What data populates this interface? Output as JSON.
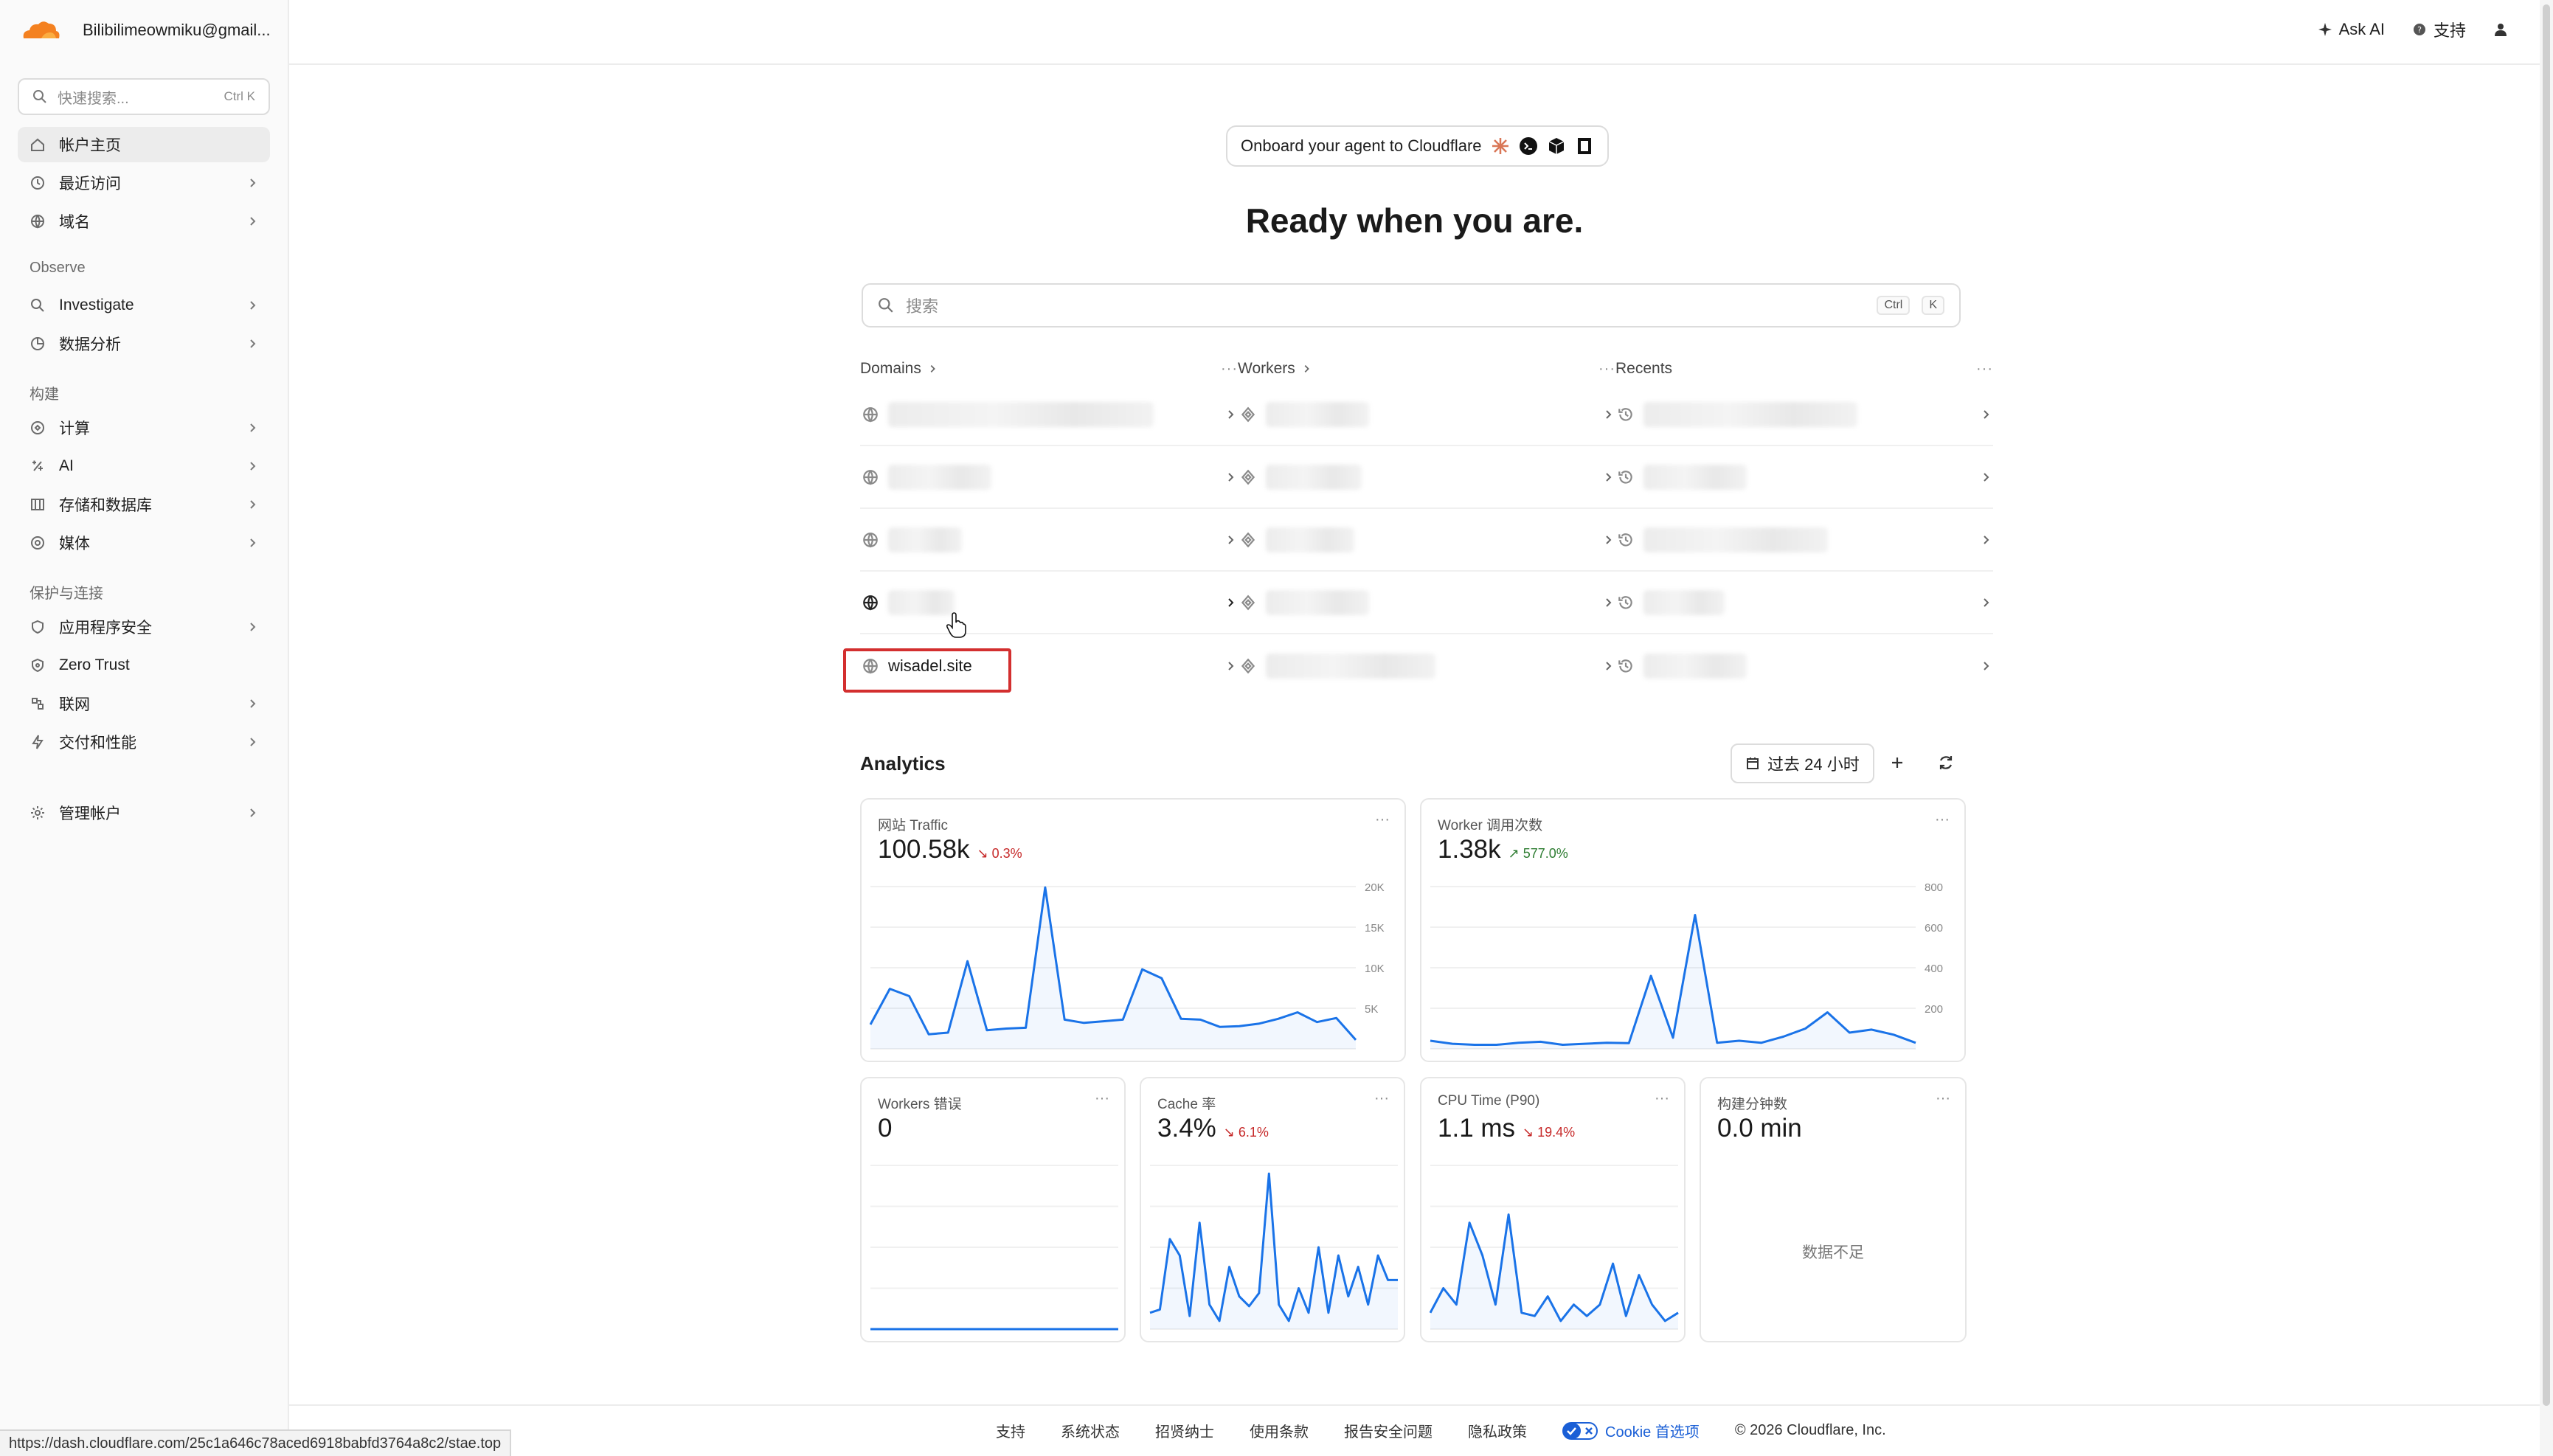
{
  "account": {
    "name": "Bilibilimeowmiku@gmail..."
  },
  "quick_search": {
    "placeholder": "快速搜索...",
    "shortcut": "Ctrl K"
  },
  "sidebar": {
    "items": [
      {
        "label": "帐户主页",
        "icon": "home-icon"
      },
      {
        "label": "最近访问",
        "icon": "clock-icon"
      },
      {
        "label": "域名",
        "icon": "globe-icon"
      },
      {
        "label": "Investigate",
        "icon": "investigate-icon"
      },
      {
        "label": "数据分析",
        "icon": "chart-pie-icon"
      },
      {
        "label": "计算",
        "icon": "compute-icon"
      },
      {
        "label": "AI",
        "icon": "ai-icon"
      },
      {
        "label": "存储和数据库",
        "icon": "storage-icon"
      },
      {
        "label": "媒体",
        "icon": "media-icon"
      },
      {
        "label": "应用程序安全",
        "icon": "shield-icon"
      },
      {
        "label": "Zero Trust",
        "icon": "zero-trust-icon"
      },
      {
        "label": "联网",
        "icon": "network-icon"
      },
      {
        "label": "交付和性能",
        "icon": "bolt-icon"
      },
      {
        "label": "管理帐户",
        "icon": "gear-icon"
      }
    ],
    "sections": {
      "observe": "Observe",
      "build": "构建",
      "protect": "保护与连接"
    }
  },
  "topbar": {
    "ask_ai": "Ask AI",
    "support": "支持"
  },
  "onboard": {
    "label": "Onboard your agent to Cloudflare"
  },
  "headline": "Ready when you are.",
  "main_search": {
    "placeholder": "搜索",
    "kbd1": "Ctrl",
    "kbd2": "K"
  },
  "columns": {
    "domains": {
      "title": "Domains",
      "visible_item": "wisadel.site"
    },
    "workers": {
      "title": "Workers"
    },
    "recents": {
      "title": "Recents"
    }
  },
  "analytics": {
    "title": "Analytics",
    "time_range": "过去 24 小时",
    "cards": {
      "traffic": {
        "title": "网站 Traffic",
        "value": "100.58k",
        "change": "↘ 0.3%",
        "trend": "down",
        "y_ticks": [
          "20K",
          "15K",
          "10K",
          "5K"
        ]
      },
      "worker_calls": {
        "title": "Worker 调用次数",
        "value": "1.38k",
        "change": "↗ 577.0%",
        "trend": "up",
        "y_ticks": [
          "800",
          "600",
          "400",
          "200"
        ]
      },
      "worker_errors": {
        "title": "Workers 错误",
        "value": "0"
      },
      "cache": {
        "title": "Cache 率",
        "value": "3.4%",
        "change": "↘ 6.1%",
        "trend": "down"
      },
      "cpu": {
        "title": "CPU Time (P90)",
        "value": "1.1 ms",
        "change": "↘ 19.4%",
        "trend": "down"
      },
      "build_minutes": {
        "title": "构建分钟数",
        "value": "0.0 min",
        "empty_text": "数据不足"
      }
    }
  },
  "footer": {
    "links": [
      "支持",
      "系统状态",
      "招贤纳士",
      "使用条款",
      "报告安全问题",
      "隐私政策"
    ],
    "cookie": "Cookie 首选项",
    "copyright": "© 2026 Cloudflare, Inc."
  },
  "status_url": "https://dash.cloudflare.com/25c1a646c78aced6918babfd3764a8c2/stae.top",
  "colors": {
    "accent": "#1a73e8",
    "brand_orange": "#f48120",
    "highlight": "#d32f2f"
  },
  "chart_data": [
    {
      "type": "line",
      "title": "网站 Traffic",
      "ylim": [
        0,
        20000
      ],
      "values": [
        3000,
        7400,
        6500,
        1800,
        2000,
        10800,
        2300,
        2500,
        2600,
        19900,
        3600,
        3200,
        3400,
        3600,
        9800,
        8700,
        3700,
        3600,
        2700,
        2800,
        3100,
        3700,
        4500,
        3300,
        3800,
        1100
      ]
    },
    {
      "type": "line",
      "title": "Worker 调用次数",
      "ylim": [
        0,
        800
      ],
      "values": [
        40,
        25,
        20,
        20,
        30,
        35,
        20,
        25,
        30,
        28,
        360,
        55,
        660,
        30,
        40,
        30,
        60,
        100,
        180,
        80,
        95,
        70,
        30
      ]
    },
    {
      "type": "line",
      "title": "Workers 错误",
      "ylim": [
        0,
        1
      ],
      "values": [
        0,
        0,
        0,
        0,
        0,
        0,
        0,
        0,
        0,
        0,
        0,
        0
      ]
    },
    {
      "type": "line",
      "title": "Cache 率",
      "ylim": [
        0,
        1
      ],
      "values": [
        0.1,
        0.12,
        0.55,
        0.45,
        0.08,
        0.65,
        0.15,
        0.05,
        0.38,
        0.2,
        0.14,
        0.22,
        0.95,
        0.15,
        0.05,
        0.25,
        0.1,
        0.5,
        0.1,
        0.45,
        0.2,
        0.38,
        0.15,
        0.45,
        0.3,
        0.3
      ]
    },
    {
      "type": "line",
      "title": "CPU Time (P90)",
      "ylim": [
        0,
        1
      ],
      "values": [
        0.1,
        0.25,
        0.15,
        0.65,
        0.45,
        0.15,
        0.7,
        0.1,
        0.08,
        0.2,
        0.05,
        0.15,
        0.08,
        0.15,
        0.4,
        0.08,
        0.33,
        0.15,
        0.05,
        0.1
      ]
    }
  ]
}
